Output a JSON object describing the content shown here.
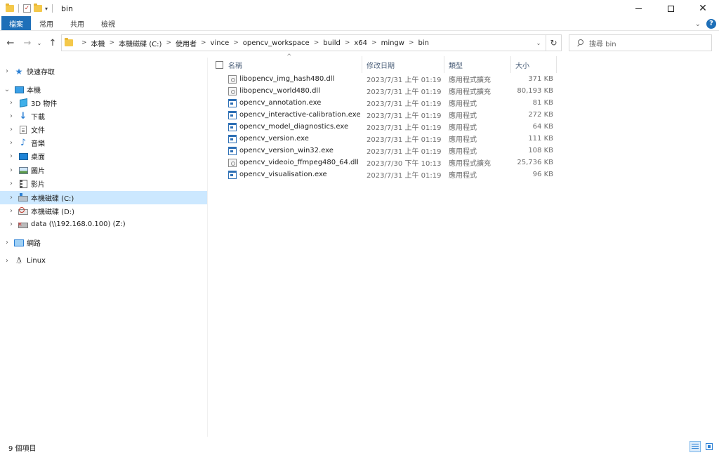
{
  "window": {
    "title": "bin",
    "controls": {
      "minimize": "—",
      "maximize": "☐",
      "close": "✕"
    }
  },
  "ribbon": {
    "tabs": [
      "檔案",
      "常用",
      "共用",
      "檢視"
    ],
    "expand_icon": "chevron-down-icon",
    "help_label": "?"
  },
  "address": {
    "path": [
      "本機",
      "本機磁碟 (C:)",
      "使用者",
      "vince",
      "opencv_workspace",
      "build",
      "x64",
      "mingw",
      "bin"
    ],
    "separator": ">"
  },
  "search": {
    "placeholder": "搜尋 bin"
  },
  "nav_pane": {
    "items": [
      {
        "label": "快速存取",
        "icon": "star-icon"
      },
      {
        "label": "本機",
        "icon": "computer-icon"
      },
      {
        "label": "3D 物件",
        "icon": "3d-objects-icon"
      },
      {
        "label": "下載",
        "icon": "download-icon"
      },
      {
        "label": "文件",
        "icon": "document-icon"
      },
      {
        "label": "音樂",
        "icon": "music-icon"
      },
      {
        "label": "桌面",
        "icon": "desktop-icon"
      },
      {
        "label": "圖片",
        "icon": "pictures-icon"
      },
      {
        "label": "影片",
        "icon": "videos-icon"
      },
      {
        "label": "本機磁碟 (C:)",
        "icon": "drive-c-icon",
        "selected": true
      },
      {
        "label": "本機磁碟 (D:)",
        "icon": "drive-d-icon"
      },
      {
        "label": "data (\\\\192.168.0.100) (Z:)",
        "icon": "network-drive-icon"
      },
      {
        "label": "網路",
        "icon": "network-icon"
      },
      {
        "label": "Linux",
        "icon": "linux-icon"
      }
    ]
  },
  "file_list": {
    "columns": {
      "name": "名稱",
      "date": "修改日期",
      "type": "類型",
      "size": "大小"
    },
    "sort_indicator": "^",
    "rows": [
      {
        "name": "libopencv_img_hash480.dll",
        "date": "2023/7/31 上午 01:19",
        "type": "應用程式擴充",
        "size": "371 KB",
        "kind": "dll"
      },
      {
        "name": "libopencv_world480.dll",
        "date": "2023/7/31 上午 01:19",
        "type": "應用程式擴充",
        "size": "80,193 KB",
        "kind": "dll"
      },
      {
        "name": "opencv_annotation.exe",
        "date": "2023/7/31 上午 01:19",
        "type": "應用程式",
        "size": "81 KB",
        "kind": "exe"
      },
      {
        "name": "opencv_interactive-calibration.exe",
        "date": "2023/7/31 上午 01:19",
        "type": "應用程式",
        "size": "272 KB",
        "kind": "exe"
      },
      {
        "name": "opencv_model_diagnostics.exe",
        "date": "2023/7/31 上午 01:19",
        "type": "應用程式",
        "size": "64 KB",
        "kind": "exe"
      },
      {
        "name": "opencv_version.exe",
        "date": "2023/7/31 上午 01:19",
        "type": "應用程式",
        "size": "111 KB",
        "kind": "exe"
      },
      {
        "name": "opencv_version_win32.exe",
        "date": "2023/7/31 上午 01:19",
        "type": "應用程式",
        "size": "108 KB",
        "kind": "exe"
      },
      {
        "name": "opencv_videoio_ffmpeg480_64.dll",
        "date": "2023/7/30 下午 10:13",
        "type": "應用程式擴充",
        "size": "25,736 KB",
        "kind": "dll"
      },
      {
        "name": "opencv_visualisation.exe",
        "date": "2023/7/31 上午 01:19",
        "type": "應用程式",
        "size": "96 KB",
        "kind": "exe"
      }
    ]
  },
  "status": {
    "item_count": "9 個項目"
  },
  "colors": {
    "accent": "#1e6fb8",
    "selection": "#cce8ff",
    "header_text": "#4c607a"
  }
}
